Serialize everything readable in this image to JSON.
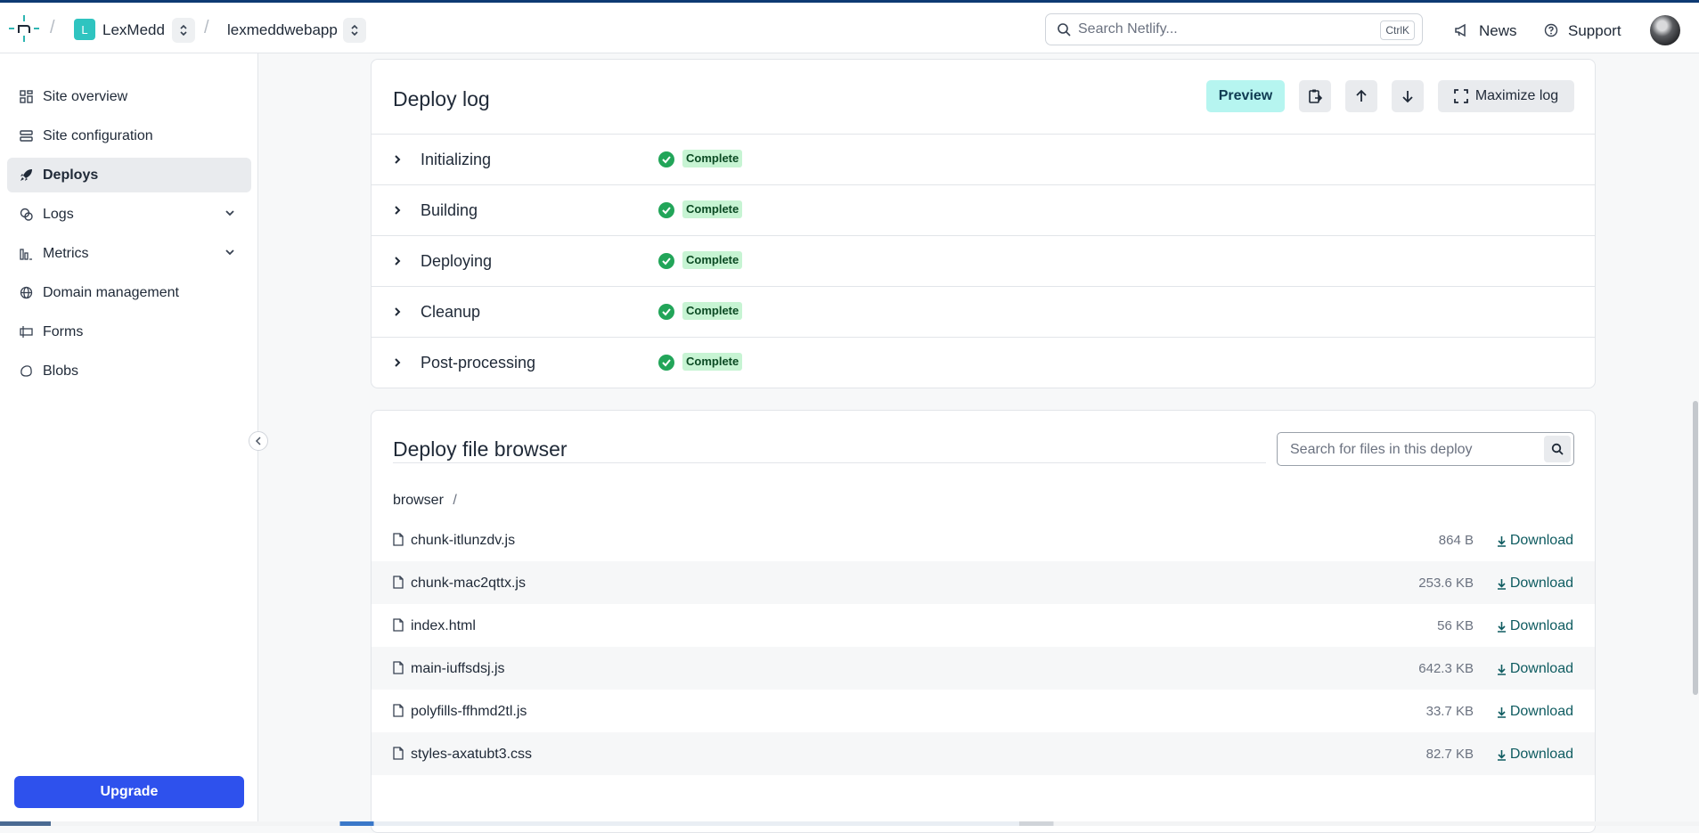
{
  "header": {
    "team_initial": "L",
    "team_name": "LexMedd",
    "site_name": "lexmeddwebapp",
    "search_placeholder": "Search Netlify...",
    "search_shortcut": "CtrlK",
    "news_label": "News",
    "support_label": "Support"
  },
  "sidebar": {
    "items": [
      {
        "label": "Site overview",
        "icon": "grid-icon"
      },
      {
        "label": "Site configuration",
        "icon": "settings-list-icon"
      },
      {
        "label": "Deploys",
        "icon": "rocket-icon",
        "active": true
      },
      {
        "label": "Logs",
        "icon": "logs-icon",
        "expandable": true
      },
      {
        "label": "Metrics",
        "icon": "bar-chart-icon",
        "expandable": true
      },
      {
        "label": "Domain management",
        "icon": "globe-icon"
      },
      {
        "label": "Forms",
        "icon": "form-icon"
      },
      {
        "label": "Blobs",
        "icon": "blob-icon"
      }
    ],
    "upgrade_label": "Upgrade"
  },
  "deploy_log": {
    "title": "Deploy log",
    "preview_label": "Preview",
    "maximize_label": "Maximize log",
    "steps": [
      {
        "label": "Initializing",
        "status": "Complete"
      },
      {
        "label": "Building",
        "status": "Complete"
      },
      {
        "label": "Deploying",
        "status": "Complete"
      },
      {
        "label": "Cleanup",
        "status": "Complete"
      },
      {
        "label": "Post-processing",
        "status": "Complete"
      }
    ]
  },
  "file_browser": {
    "title": "Deploy file browser",
    "search_placeholder": "Search for files in this deploy",
    "breadcrumb": "browser",
    "breadcrumb_sep": "/",
    "download_label": "Download",
    "files": [
      {
        "name": "chunk-itlunzdv.js",
        "size": "864 B"
      },
      {
        "name": "chunk-mac2qttx.js",
        "size": "253.6 KB"
      },
      {
        "name": "index.html",
        "size": "56 KB"
      },
      {
        "name": "main-iuffsdsj.js",
        "size": "642.3 KB"
      },
      {
        "name": "polyfills-ffhmd2tl.js",
        "size": "33.7 KB"
      },
      {
        "name": "styles-axatubt3.css",
        "size": "82.7 KB"
      }
    ]
  },
  "colors": {
    "accent_teal": "#2fc4c0",
    "upgrade_blue": "#2e51ed",
    "complete_green": "#22a559",
    "preview_bg": "#b6f5f0"
  }
}
